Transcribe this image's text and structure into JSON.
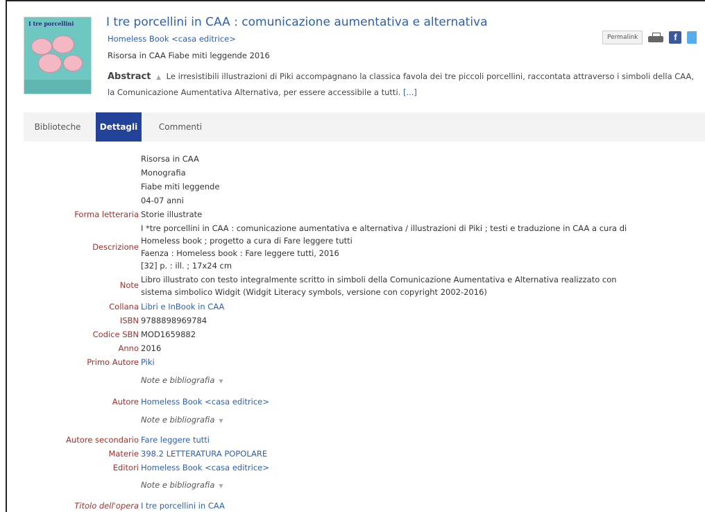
{
  "header": {
    "cover_title": "I tre porcellini",
    "title": "I tre porcellini in CAA : comunicazione aumentativa e alternativa",
    "publisher": "Homeless Book <casa editrice>",
    "resource_line": "Risorsa in CAA Fiabe miti leggende 2016",
    "abstract_label": "Abstract",
    "abstract_toggle": "▲",
    "abstract_text": "Le irresistibili illustrazioni di Piki accompagnano la classica favola dei tre piccoli porcellini, raccontata attraverso i simboli della CAA, la Comunicazione Aumentativa Alternativa, per essere accessibile a tutti.",
    "abstract_more": "[...]"
  },
  "actions": {
    "permalink": "Permalink",
    "facebook_glyph": "f",
    "icons": [
      "print-icon",
      "facebook-icon",
      "twitter-icon"
    ]
  },
  "tabs": [
    {
      "label": "Biblioteche",
      "active": false
    },
    {
      "label": "Dettagli",
      "active": true
    },
    {
      "label": "Commenti",
      "active": false
    }
  ],
  "details": {
    "type_lines": [
      "Risorsa in CAA",
      "Monografia",
      "Fiabe miti leggende",
      "04-07 anni"
    ],
    "forma_letteraria": {
      "label": "Forma letteraria",
      "value": "Storie illustrate"
    },
    "descrizione": {
      "label": "Descrizione",
      "lines": [
        "I *tre porcellini in CAA : comunicazione aumentativa e alternativa / illustrazioni di Piki ; testi e traduzione in CAA a cura di",
        "Homeless book ; progetto a cura di Fare leggere tutti",
        "Faenza : Homeless book : Fare leggere tutti, 2016",
        "[32] p. : ill. ; 17x24 cm"
      ]
    },
    "note": {
      "label": "Note",
      "lines": [
        "Libro illustrato con testo integralmente scritto in simboli della Comunicazione Aumentativa e Alternativa realizzato con",
        "sistema simbolico Widgit (Widgit Literacy symbols, versione con copyright 2002-2016)"
      ]
    },
    "collana": {
      "label": "Collana",
      "value": "Libri e InBook in CAA"
    },
    "isbn": {
      "label": "ISBN",
      "value": "9788898969784"
    },
    "codice_sbn": {
      "label": "Codice SBN",
      "value": "MOD1659882"
    },
    "anno": {
      "label": "Anno",
      "value": "2016"
    },
    "primo_autore": {
      "label": "Primo Autore",
      "value": "Piki"
    },
    "note_bibliografia": "Note e bibliografia",
    "note_caret": "▼",
    "autore": {
      "label": "Autore",
      "value": "Homeless Book <casa editrice>"
    },
    "autore_secondario": {
      "label": "Autore secondario",
      "value": "Fare leggere tutti"
    },
    "materie": {
      "label": "Materie",
      "value": "398.2 LETTERATURA POPOLARE"
    },
    "editori": {
      "label": "Editori",
      "value": "Homeless Book <casa editrice>"
    },
    "titolo_opera": {
      "label": "Titolo dell'opera",
      "value": "I tre porcellini in CAA"
    }
  },
  "colors": {
    "link": "#2e5fb0",
    "label": "#a0322f",
    "active_tab": "#23439a",
    "tab_bar": "#f3f3f3"
  }
}
